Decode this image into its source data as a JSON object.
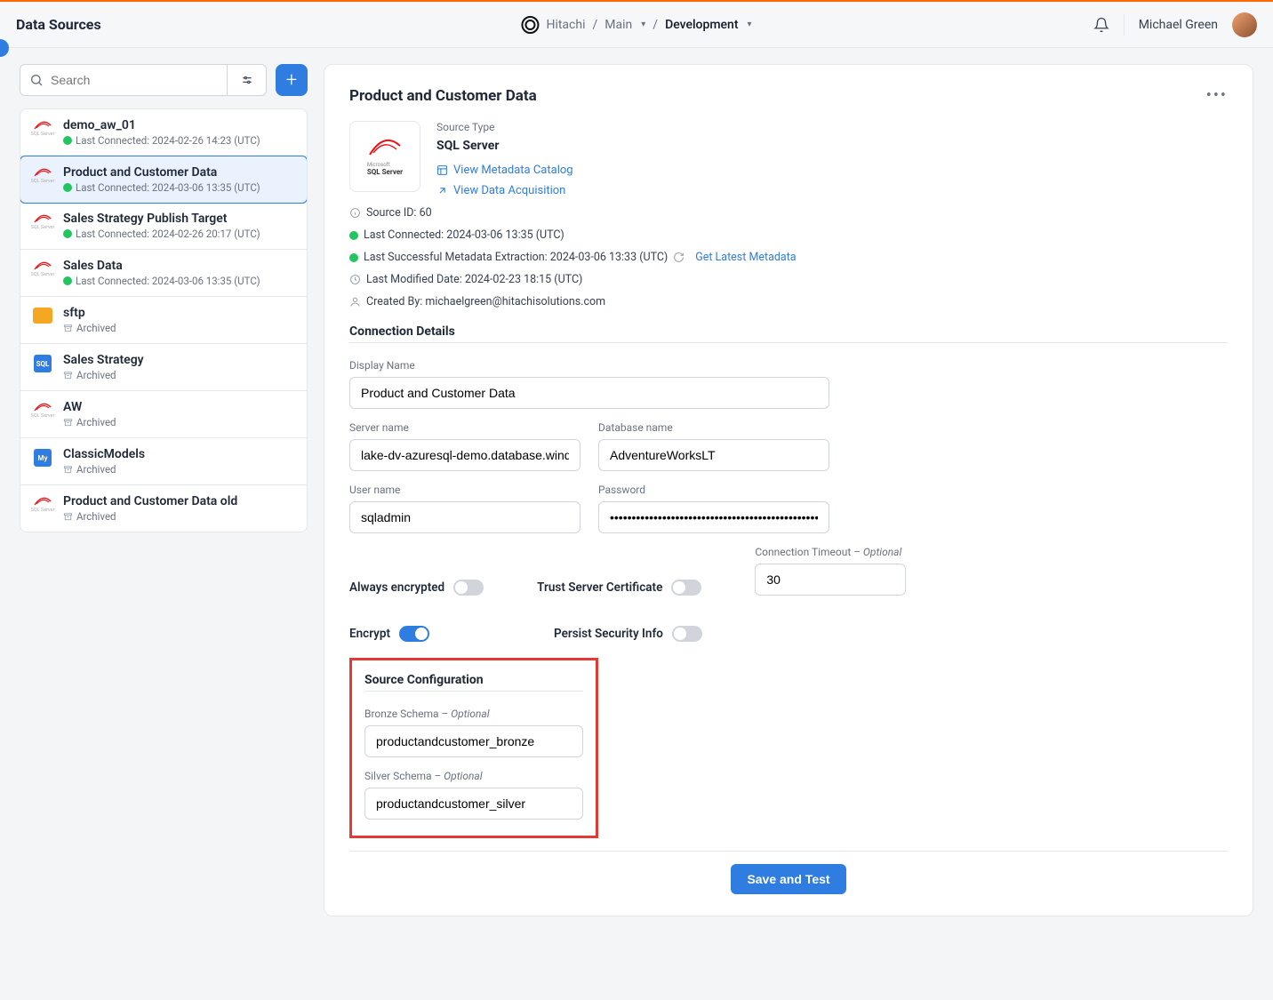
{
  "header": {
    "page_title": "Data Sources",
    "breadcrumb_org": "Hitachi",
    "breadcrumb_project": "Main",
    "breadcrumb_env": "Development",
    "user_name": "Michael Green"
  },
  "sidebar": {
    "search_placeholder": "Search",
    "items": [
      {
        "name": "demo_aw_01",
        "sub": "Last Connected: 2024-02-26 14:23 (UTC)",
        "icon": "sqlserver",
        "status": "ok"
      },
      {
        "name": "Product and Customer Data",
        "sub": "Last Connected: 2024-03-06 13:35 (UTC)",
        "icon": "sqlserver",
        "status": "ok",
        "selected": true
      },
      {
        "name": "Sales Strategy Publish Target",
        "sub": "Last Connected: 2024-02-26 20:17 (UTC)",
        "icon": "sqlserver",
        "status": "ok"
      },
      {
        "name": "Sales Data",
        "sub": "Last Connected: 2024-03-06 13:35 (UTC)",
        "icon": "sqlserver",
        "status": "ok"
      },
      {
        "name": "sftp",
        "sub": "Archived",
        "icon": "sftp",
        "status": "archived"
      },
      {
        "name": "Sales Strategy",
        "sub": "Archived",
        "icon": "sqldb",
        "status": "archived"
      },
      {
        "name": "AW",
        "sub": "Archived",
        "icon": "sqlserver",
        "status": "archived"
      },
      {
        "name": "ClassicModels",
        "sub": "Archived",
        "icon": "mysql",
        "status": "archived"
      },
      {
        "name": "Product and Customer Data old",
        "sub": "Archived",
        "icon": "sqlserver",
        "status": "archived"
      }
    ]
  },
  "detail": {
    "title": "Product and Customer Data",
    "source_type_label": "Source Type",
    "source_type": "SQL Server",
    "view_metadata_catalog": "View Metadata Catalog",
    "view_data_acquisition": "View Data Acquisition",
    "source_id_label": "Source ID: 60",
    "last_connected": "Last Connected: 2024-03-06 13:35 (UTC)",
    "last_metadata": "Last Successful Metadata Extraction: 2024-03-06 13:33 (UTC)",
    "get_latest": "Get Latest Metadata",
    "last_modified": "Last Modified Date: 2024-02-23 18:15 (UTC)",
    "created_by": "Created By: michaelgreen@hitachisolutions.com",
    "connection_details_title": "Connection Details",
    "fields": {
      "display_name_label": "Display Name",
      "display_name": "Product and Customer Data",
      "server_name_label": "Server name",
      "server_name": "lake-dv-azuresql-demo.database.windo...",
      "database_name_label": "Database name",
      "database_name": "AdventureWorksLT",
      "user_name_label": "User name",
      "user_name": "sqladmin",
      "password_label": "Password",
      "password": "••••••••••••••••••••••••••••••••••••••••••••••••••",
      "timeout_label": "Connection Timeout",
      "timeout_optional": " – Optional",
      "timeout": "30"
    },
    "toggles": {
      "always_encrypted_label": "Always encrypted",
      "always_encrypted": false,
      "trust_cert_label": "Trust Server Certificate",
      "trust_cert": false,
      "encrypt_label": "Encrypt",
      "encrypt": true,
      "persist_label": "Persist Security Info",
      "persist": false
    },
    "source_config": {
      "title": "Source Configuration",
      "bronze_label": "Bronze Schema",
      "bronze_optional": " – Optional",
      "bronze": "productandcustomer_bronze",
      "silver_label": "Silver Schema",
      "silver_optional": " – Optional",
      "silver": "productandcustomer_silver"
    },
    "save_btn": "Save and Test"
  }
}
